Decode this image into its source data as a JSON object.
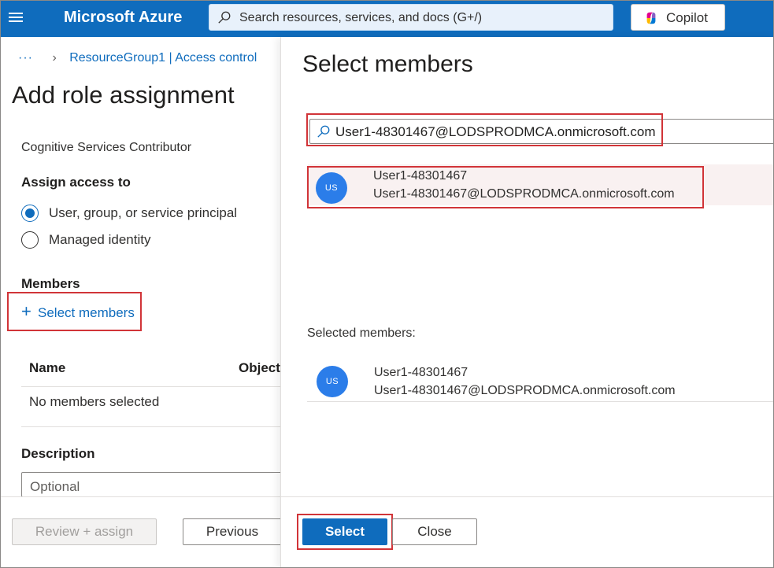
{
  "topbar": {
    "brand": "Microsoft Azure",
    "search_placeholder": "Search resources, services, and docs (G+/)",
    "copilot_label": "Copilot"
  },
  "left": {
    "breadcrumb_dots": "···",
    "breadcrumb_item": "ResourceGroup1 | Access control",
    "page_title": "Add role assignment",
    "role_name": "Cognitive Services Contributor",
    "assign_access_label": "Assign access to",
    "assign_options": [
      {
        "label": "User, group, or service principal",
        "checked": true
      },
      {
        "label": "Managed identity",
        "checked": false
      }
    ],
    "members_label": "Members",
    "select_members_link": "Select members",
    "table": {
      "columns": [
        "Name",
        "Object"
      ],
      "empty_text": "No members selected"
    },
    "description_label": "Description",
    "description_placeholder": "Optional",
    "review_button": "Review + assign",
    "previous_button": "Previous"
  },
  "flyout": {
    "title": "Select members",
    "search_value": "User1-48301467@LODSPRODMCA.onmicrosoft.com",
    "results": [
      {
        "initials": "US",
        "name": "User1-48301467",
        "email": "User1-48301467@LODSPRODMCA.onmicrosoft.com"
      }
    ],
    "selected_label": "Selected members:",
    "selected": [
      {
        "initials": "US",
        "name": "User1-48301467",
        "email": "User1-48301467@LODSPRODMCA.onmicrosoft.com"
      }
    ],
    "select_button": "Select",
    "close_button": "Close"
  },
  "colors": {
    "azure_blue": "#0f6cbd",
    "highlight_red": "#d13438",
    "avatar_blue": "#2b7de9"
  }
}
